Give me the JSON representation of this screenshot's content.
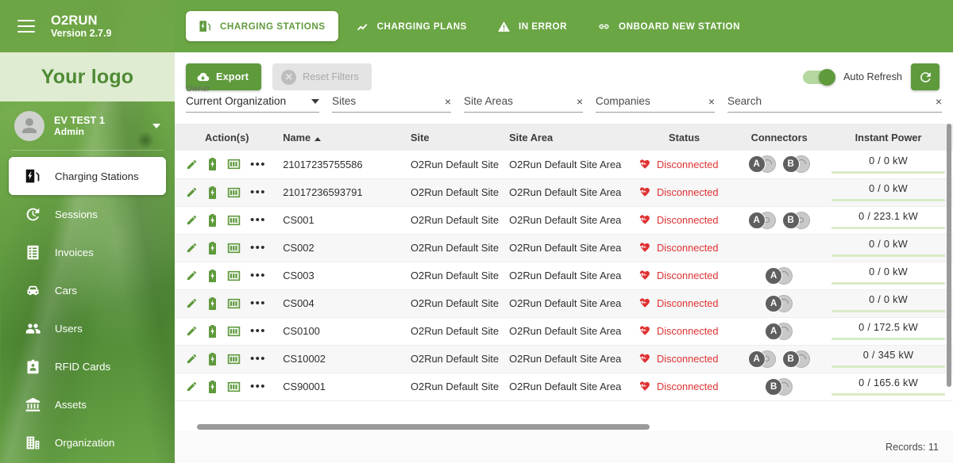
{
  "sidebar": {
    "brand_name": "O2RUN",
    "brand_version": "Version 2.7.9",
    "logo_text": "Your logo",
    "user_name": "EV TEST 1",
    "user_role": "Admin",
    "items": [
      {
        "label": "Charging Stations",
        "icon": "charging-station-icon",
        "active": true
      },
      {
        "label": "Sessions",
        "icon": "history-icon",
        "active": false
      },
      {
        "label": "Invoices",
        "icon": "invoice-icon",
        "active": false
      },
      {
        "label": "Cars",
        "icon": "car-icon",
        "active": false
      },
      {
        "label": "Users",
        "icon": "users-icon",
        "active": false
      },
      {
        "label": "RFID Cards",
        "icon": "rfid-card-icon",
        "active": false
      },
      {
        "label": "Assets",
        "icon": "bank-icon",
        "active": false
      },
      {
        "label": "Organization",
        "icon": "building-icon",
        "active": false
      }
    ]
  },
  "tabs": [
    {
      "label": "CHARGING STATIONS",
      "icon": "charging-station-icon",
      "active": true
    },
    {
      "label": "CHARGING PLANS",
      "icon": "chart-line-icon",
      "active": false
    },
    {
      "label": "IN ERROR",
      "icon": "warning-triangle-icon",
      "active": false
    },
    {
      "label": "ONBOARD NEW STATION",
      "icon": "link-icon",
      "active": false
    }
  ],
  "toolbar": {
    "export_label": "Export",
    "reset_filters_label": "Reset Filters",
    "auto_refresh_label": "Auto Refresh",
    "auto_refresh_on": true
  },
  "filters": {
    "owner_label": "Owner",
    "owner_value": "Current Organization",
    "sites_placeholder": "Sites",
    "site_areas_placeholder": "Site Areas",
    "companies_placeholder": "Companies",
    "search_placeholder": "Search",
    "clear_glyph": "×"
  },
  "table": {
    "columns": [
      {
        "key": "actions",
        "label": "Action(s)",
        "sorted": false
      },
      {
        "key": "name",
        "label": "Name",
        "sorted": true,
        "sort_dir": "asc"
      },
      {
        "key": "site",
        "label": "Site",
        "sorted": false
      },
      {
        "key": "site_area",
        "label": "Site Area",
        "sorted": false
      },
      {
        "key": "status",
        "label": "Status",
        "sorted": false
      },
      {
        "key": "connectors",
        "label": "Connectors",
        "sorted": false
      },
      {
        "key": "instant_power",
        "label": "Instant Power",
        "sorted": false
      }
    ],
    "row_actions": [
      "edit-icon",
      "battery-icon",
      "meter-icon",
      "more-icon"
    ],
    "rows": [
      {
        "name": "21017235755586",
        "site": "O2Run Default Site",
        "site_area": "O2Run Default Site Area",
        "status": "Disconnected",
        "connectors": [
          "A",
          "B"
        ],
        "connector_style": [
          "arc",
          "arc"
        ],
        "power": "0 / 0 kW"
      },
      {
        "name": "21017236593791",
        "site": "O2Run Default Site",
        "site_area": "O2Run Default Site Area",
        "status": "Disconnected",
        "connectors": [],
        "connector_style": [],
        "power": "0 / 0 kW"
      },
      {
        "name": "CS001",
        "site": "O2Run Default Site",
        "site_area": "O2Run Default Site Area",
        "status": "Disconnected",
        "connectors": [
          "A",
          "B"
        ],
        "connector_style": [
          "dot",
          "dot"
        ],
        "power": "0 / 223.1 kW"
      },
      {
        "name": "CS002",
        "site": "O2Run Default Site",
        "site_area": "O2Run Default Site Area",
        "status": "Disconnected",
        "connectors": [],
        "connector_style": [],
        "power": "0 / 0 kW"
      },
      {
        "name": "CS003",
        "site": "O2Run Default Site",
        "site_area": "O2Run Default Site Area",
        "status": "Disconnected",
        "connectors": [
          "A"
        ],
        "connector_style": [
          "arc"
        ],
        "power": "0 / 0 kW"
      },
      {
        "name": "CS004",
        "site": "O2Run Default Site",
        "site_area": "O2Run Default Site Area",
        "status": "Disconnected",
        "connectors": [
          "A"
        ],
        "connector_style": [
          "arc"
        ],
        "power": "0 / 0 kW"
      },
      {
        "name": "CS0100",
        "site": "O2Run Default Site",
        "site_area": "O2Run Default Site Area",
        "status": "Disconnected",
        "connectors": [
          "A"
        ],
        "connector_style": [
          "arc"
        ],
        "power": "0 / 172.5 kW"
      },
      {
        "name": "CS10002",
        "site": "O2Run Default Site",
        "site_area": "O2Run Default Site Area",
        "status": "Disconnected",
        "connectors": [
          "A",
          "B"
        ],
        "connector_style": [
          "dot",
          "arc"
        ],
        "power": "0 / 345 kW"
      },
      {
        "name": "CS90001",
        "site": "O2Run Default Site",
        "site_area": "O2Run Default Site Area",
        "status": "Disconnected",
        "connectors": [
          "B"
        ],
        "connector_style": [
          "arc"
        ],
        "power": "0 / 165.6 kW"
      }
    ]
  },
  "footer": {
    "records_label": "Records: 11"
  },
  "colors": {
    "brand_green": "#6ba644",
    "accent_green": "#5f9a3d",
    "logo_band": "#dfecd2",
    "status_red": "#e03131",
    "power_bar": "#d8ebc6"
  }
}
